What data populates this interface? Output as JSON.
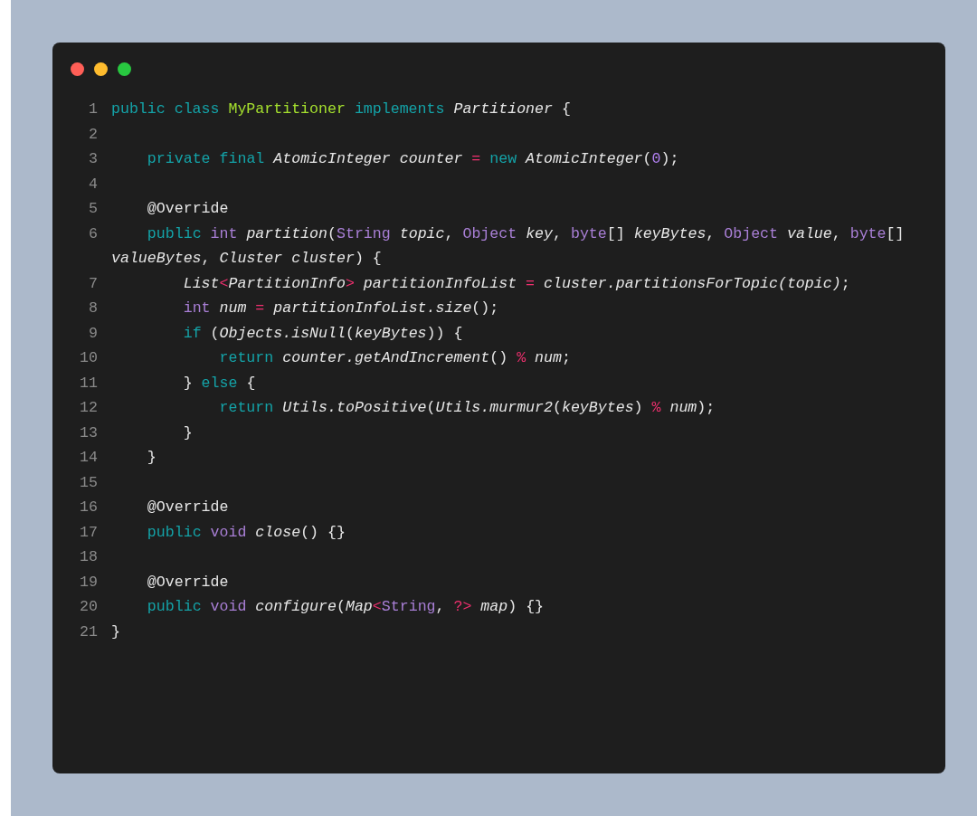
{
  "window": {
    "controls": [
      {
        "color": "#ff5f57"
      },
      {
        "color": "#febc2e"
      },
      {
        "color": "#28c840"
      }
    ]
  },
  "code": {
    "lines": [
      {
        "number": "1",
        "tokens": [
          {
            "kind": "keyword",
            "text": "public class "
          },
          {
            "kind": "class",
            "text": "MyPartitioner "
          },
          {
            "kind": "keyword",
            "text": "implements "
          },
          {
            "kind": "italic",
            "text": "Partitioner"
          },
          {
            "kind": "plain",
            "text": " {"
          }
        ]
      },
      {
        "number": "2"
      },
      {
        "number": "3",
        "tokens": [
          {
            "kind": "keyword",
            "text": "    private final "
          },
          {
            "kind": "italic",
            "text": "AtomicInteger counter "
          },
          {
            "kind": "operator",
            "text": "= "
          },
          {
            "kind": "keyword",
            "text": "new "
          },
          {
            "kind": "italic",
            "text": "AtomicInteger"
          },
          {
            "kind": "plain",
            "text": "("
          },
          {
            "kind": "number",
            "text": "0"
          },
          {
            "kind": "plain",
            "text": ");"
          }
        ]
      },
      {
        "number": "4"
      },
      {
        "number": "5",
        "tokens": [
          {
            "kind": "plain",
            "text": "    @Override"
          }
        ]
      },
      {
        "number": "6",
        "tokens": [
          {
            "kind": "keyword",
            "text": "    public "
          },
          {
            "kind": "type",
            "text": "int "
          },
          {
            "kind": "italic",
            "text": "partition"
          },
          {
            "kind": "plain",
            "text": "("
          },
          {
            "kind": "type",
            "text": "String "
          },
          {
            "kind": "italic",
            "text": "topic"
          },
          {
            "kind": "plain",
            "text": ", "
          },
          {
            "kind": "type",
            "text": "Object "
          },
          {
            "kind": "italic",
            "text": "key"
          },
          {
            "kind": "plain",
            "text": ", "
          },
          {
            "kind": "type",
            "text": "byte"
          },
          {
            "kind": "plain",
            "text": "[] "
          },
          {
            "kind": "italic",
            "text": "keyBytes"
          },
          {
            "kind": "plain",
            "text": ", "
          },
          {
            "kind": "type",
            "text": "Object "
          },
          {
            "kind": "italic",
            "text": "value"
          },
          {
            "kind": "plain",
            "text": ", "
          },
          {
            "kind": "type",
            "text": "byte"
          },
          {
            "kind": "plain",
            "text": "[] "
          },
          {
            "kind": "italic",
            "text": "valueBytes"
          },
          {
            "kind": "plain",
            "text": ", "
          },
          {
            "kind": "italic",
            "text": "Cluster cluster"
          },
          {
            "kind": "plain",
            "text": ") {"
          }
        ]
      },
      {
        "number": "7",
        "tokens": [
          {
            "kind": "italic",
            "text": "        List"
          },
          {
            "kind": "operator",
            "text": "<"
          },
          {
            "kind": "italic",
            "text": "PartitionInfo"
          },
          {
            "kind": "operator",
            "text": "> "
          },
          {
            "kind": "italic",
            "text": "partitionInfoList "
          },
          {
            "kind": "operator",
            "text": "= "
          },
          {
            "kind": "italic",
            "text": "cluster.partitionsForTopic(topic)"
          },
          {
            "kind": "plain",
            "text": ";"
          }
        ]
      },
      {
        "number": "8",
        "tokens": [
          {
            "kind": "type",
            "text": "        int "
          },
          {
            "kind": "italic",
            "text": "num "
          },
          {
            "kind": "operator",
            "text": "= "
          },
          {
            "kind": "italic",
            "text": "partitionInfoList.size"
          },
          {
            "kind": "plain",
            "text": "();"
          }
        ]
      },
      {
        "number": "9",
        "tokens": [
          {
            "kind": "keyword",
            "text": "        if "
          },
          {
            "kind": "plain",
            "text": "("
          },
          {
            "kind": "italic",
            "text": "Objects.isNull"
          },
          {
            "kind": "plain",
            "text": "("
          },
          {
            "kind": "italic",
            "text": "keyBytes"
          },
          {
            "kind": "plain",
            "text": ")) {"
          }
        ]
      },
      {
        "number": "10",
        "tokens": [
          {
            "kind": "keyword",
            "text": "            return "
          },
          {
            "kind": "italic",
            "text": "counter.getAndIncrement"
          },
          {
            "kind": "plain",
            "text": "() "
          },
          {
            "kind": "operator",
            "text": "% "
          },
          {
            "kind": "italic",
            "text": "num"
          },
          {
            "kind": "plain",
            "text": ";"
          }
        ]
      },
      {
        "number": "11",
        "tokens": [
          {
            "kind": "plain",
            "text": "        } "
          },
          {
            "kind": "keyword",
            "text": "else"
          },
          {
            "kind": "plain",
            "text": " {"
          }
        ]
      },
      {
        "number": "12",
        "tokens": [
          {
            "kind": "keyword",
            "text": "            return "
          },
          {
            "kind": "italic",
            "text": "Utils.toPositive"
          },
          {
            "kind": "plain",
            "text": "("
          },
          {
            "kind": "italic",
            "text": "Utils.murmur2"
          },
          {
            "kind": "plain",
            "text": "("
          },
          {
            "kind": "italic",
            "text": "keyBytes"
          },
          {
            "kind": "plain",
            "text": ") "
          },
          {
            "kind": "operator",
            "text": "% "
          },
          {
            "kind": "italic",
            "text": "num"
          },
          {
            "kind": "plain",
            "text": ");"
          }
        ]
      },
      {
        "number": "13",
        "tokens": [
          {
            "kind": "plain",
            "text": "        }"
          }
        ]
      },
      {
        "number": "14",
        "tokens": [
          {
            "kind": "plain",
            "text": "    }"
          }
        ]
      },
      {
        "number": "15"
      },
      {
        "number": "16",
        "tokens": [
          {
            "kind": "plain",
            "text": "    @Override"
          }
        ]
      },
      {
        "number": "17",
        "tokens": [
          {
            "kind": "keyword",
            "text": "    public "
          },
          {
            "kind": "type",
            "text": "void "
          },
          {
            "kind": "italic",
            "text": "close"
          },
          {
            "kind": "plain",
            "text": "() {}"
          }
        ]
      },
      {
        "number": "18"
      },
      {
        "number": "19",
        "tokens": [
          {
            "kind": "plain",
            "text": "    @Override"
          }
        ]
      },
      {
        "number": "20",
        "tokens": [
          {
            "kind": "keyword",
            "text": "    public "
          },
          {
            "kind": "type",
            "text": "void "
          },
          {
            "kind": "italic",
            "text": "configure"
          },
          {
            "kind": "plain",
            "text": "("
          },
          {
            "kind": "italic",
            "text": "Map"
          },
          {
            "kind": "operator",
            "text": "<"
          },
          {
            "kind": "type",
            "text": "String"
          },
          {
            "kind": "plain",
            "text": ", "
          },
          {
            "kind": "operator",
            "text": "?> "
          },
          {
            "kind": "italic",
            "text": "map"
          },
          {
            "kind": "plain",
            "text": ") {}"
          }
        ]
      },
      {
        "number": "21",
        "tokens": [
          {
            "kind": "plain",
            "text": "}"
          }
        ]
      }
    ]
  }
}
